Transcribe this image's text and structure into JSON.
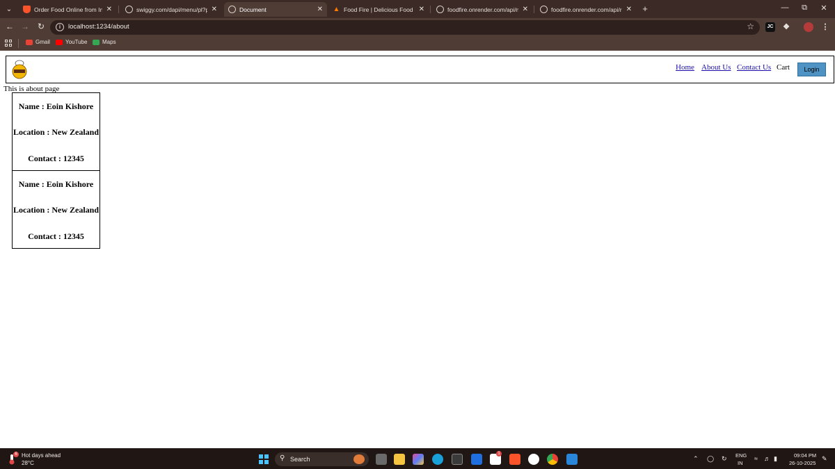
{
  "browser": {
    "tabs": [
      {
        "title": "Order Food Online from India's",
        "icon": "brave-icon",
        "active": false
      },
      {
        "title": "swiggy.com/dapi/menu/pl?pag",
        "icon": "globe-icon",
        "active": false
      },
      {
        "title": "Document",
        "icon": "globe-icon",
        "active": true
      },
      {
        "title": "Food Fire | Delicious Food for y",
        "icon": "fire-icon",
        "active": false
      },
      {
        "title": "foodfire.onrender.com/api/me",
        "icon": "globe-icon",
        "active": false
      },
      {
        "title": "foodfire.onrender.com/api/rest",
        "icon": "globe-icon",
        "active": false
      }
    ],
    "url": "localhost:1234/about",
    "bookmarks": [
      {
        "label": "Gmail",
        "icon": "gmail-icon"
      },
      {
        "label": "YouTube",
        "icon": "youtube-icon"
      },
      {
        "label": "Maps",
        "icon": "maps-icon"
      }
    ],
    "colors": {
      "frame": "#3c2a26",
      "toolbar": "#4f3c35",
      "omnibox": "#2e201c"
    }
  },
  "page": {
    "nav": {
      "home": "Home",
      "about": "About Us",
      "contact": "Contact Us",
      "cart": "Cart",
      "login": "Login"
    },
    "intro": "This is about page",
    "cards": [
      {
        "name": "Name : Eoin Kishore",
        "location": "Location : New Zealand",
        "contact": "Contact : 12345"
      },
      {
        "name": "Name : Eoin Kishore",
        "location": "Location : New Zealand",
        "contact": "Contact : 12345"
      }
    ],
    "colors": {
      "link": "#1a0dab",
      "login_button": "#4e93c4"
    }
  },
  "taskbar": {
    "weather_title": "Hot days ahead",
    "weather_temp": "28°C",
    "weather_badge": "6",
    "search_label": "Search",
    "language": "ENG",
    "region": "IN",
    "time": "09:04 PM",
    "date": "26-10-2025",
    "linkedin_badge": "1"
  }
}
